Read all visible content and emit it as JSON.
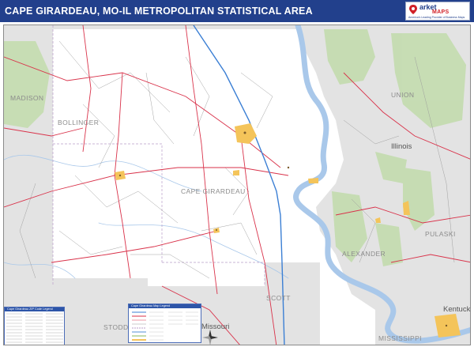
{
  "header": {
    "title": "CAPE GIRARDEAU, MO-IL METROPOLITAN STATISTICAL AREA",
    "background": "#22408c"
  },
  "logo": {
    "market": "arket",
    "maps": "MAPS",
    "tagline": "America's Leading Provider of Business Maps",
    "icon": "map-pin-icon"
  },
  "map": {
    "counties": {
      "madison": "MADISON",
      "bollinger": "BOLLINGER",
      "cape_girardeau": "CAPE GIRARDEAU",
      "union": "UNION",
      "alexander": "ALEXANDER",
      "pulaski": "PULASKI",
      "scott": "SCOTT",
      "stoddard": "STODD",
      "mississippi": "MISSISSIPPI"
    },
    "states": {
      "illinois": "Illinois",
      "missouri": "Missouri",
      "kentucky": "Kentucky"
    },
    "colors": {
      "land": "#ffffff",
      "outside_area": "#e3e3e3",
      "river": "#a9c8ea",
      "forest": "#c3dcae",
      "urban": "#f4c45a",
      "highway": "#d9324a",
      "interstate": "#3b7fd4"
    }
  },
  "legend_left": {
    "title": "Cape Girardeau ZIP Code Legend"
  },
  "legend_center": {
    "title": "Cape Girardeau Map Legend"
  },
  "compass": {
    "icon": "compass-rose-icon"
  }
}
